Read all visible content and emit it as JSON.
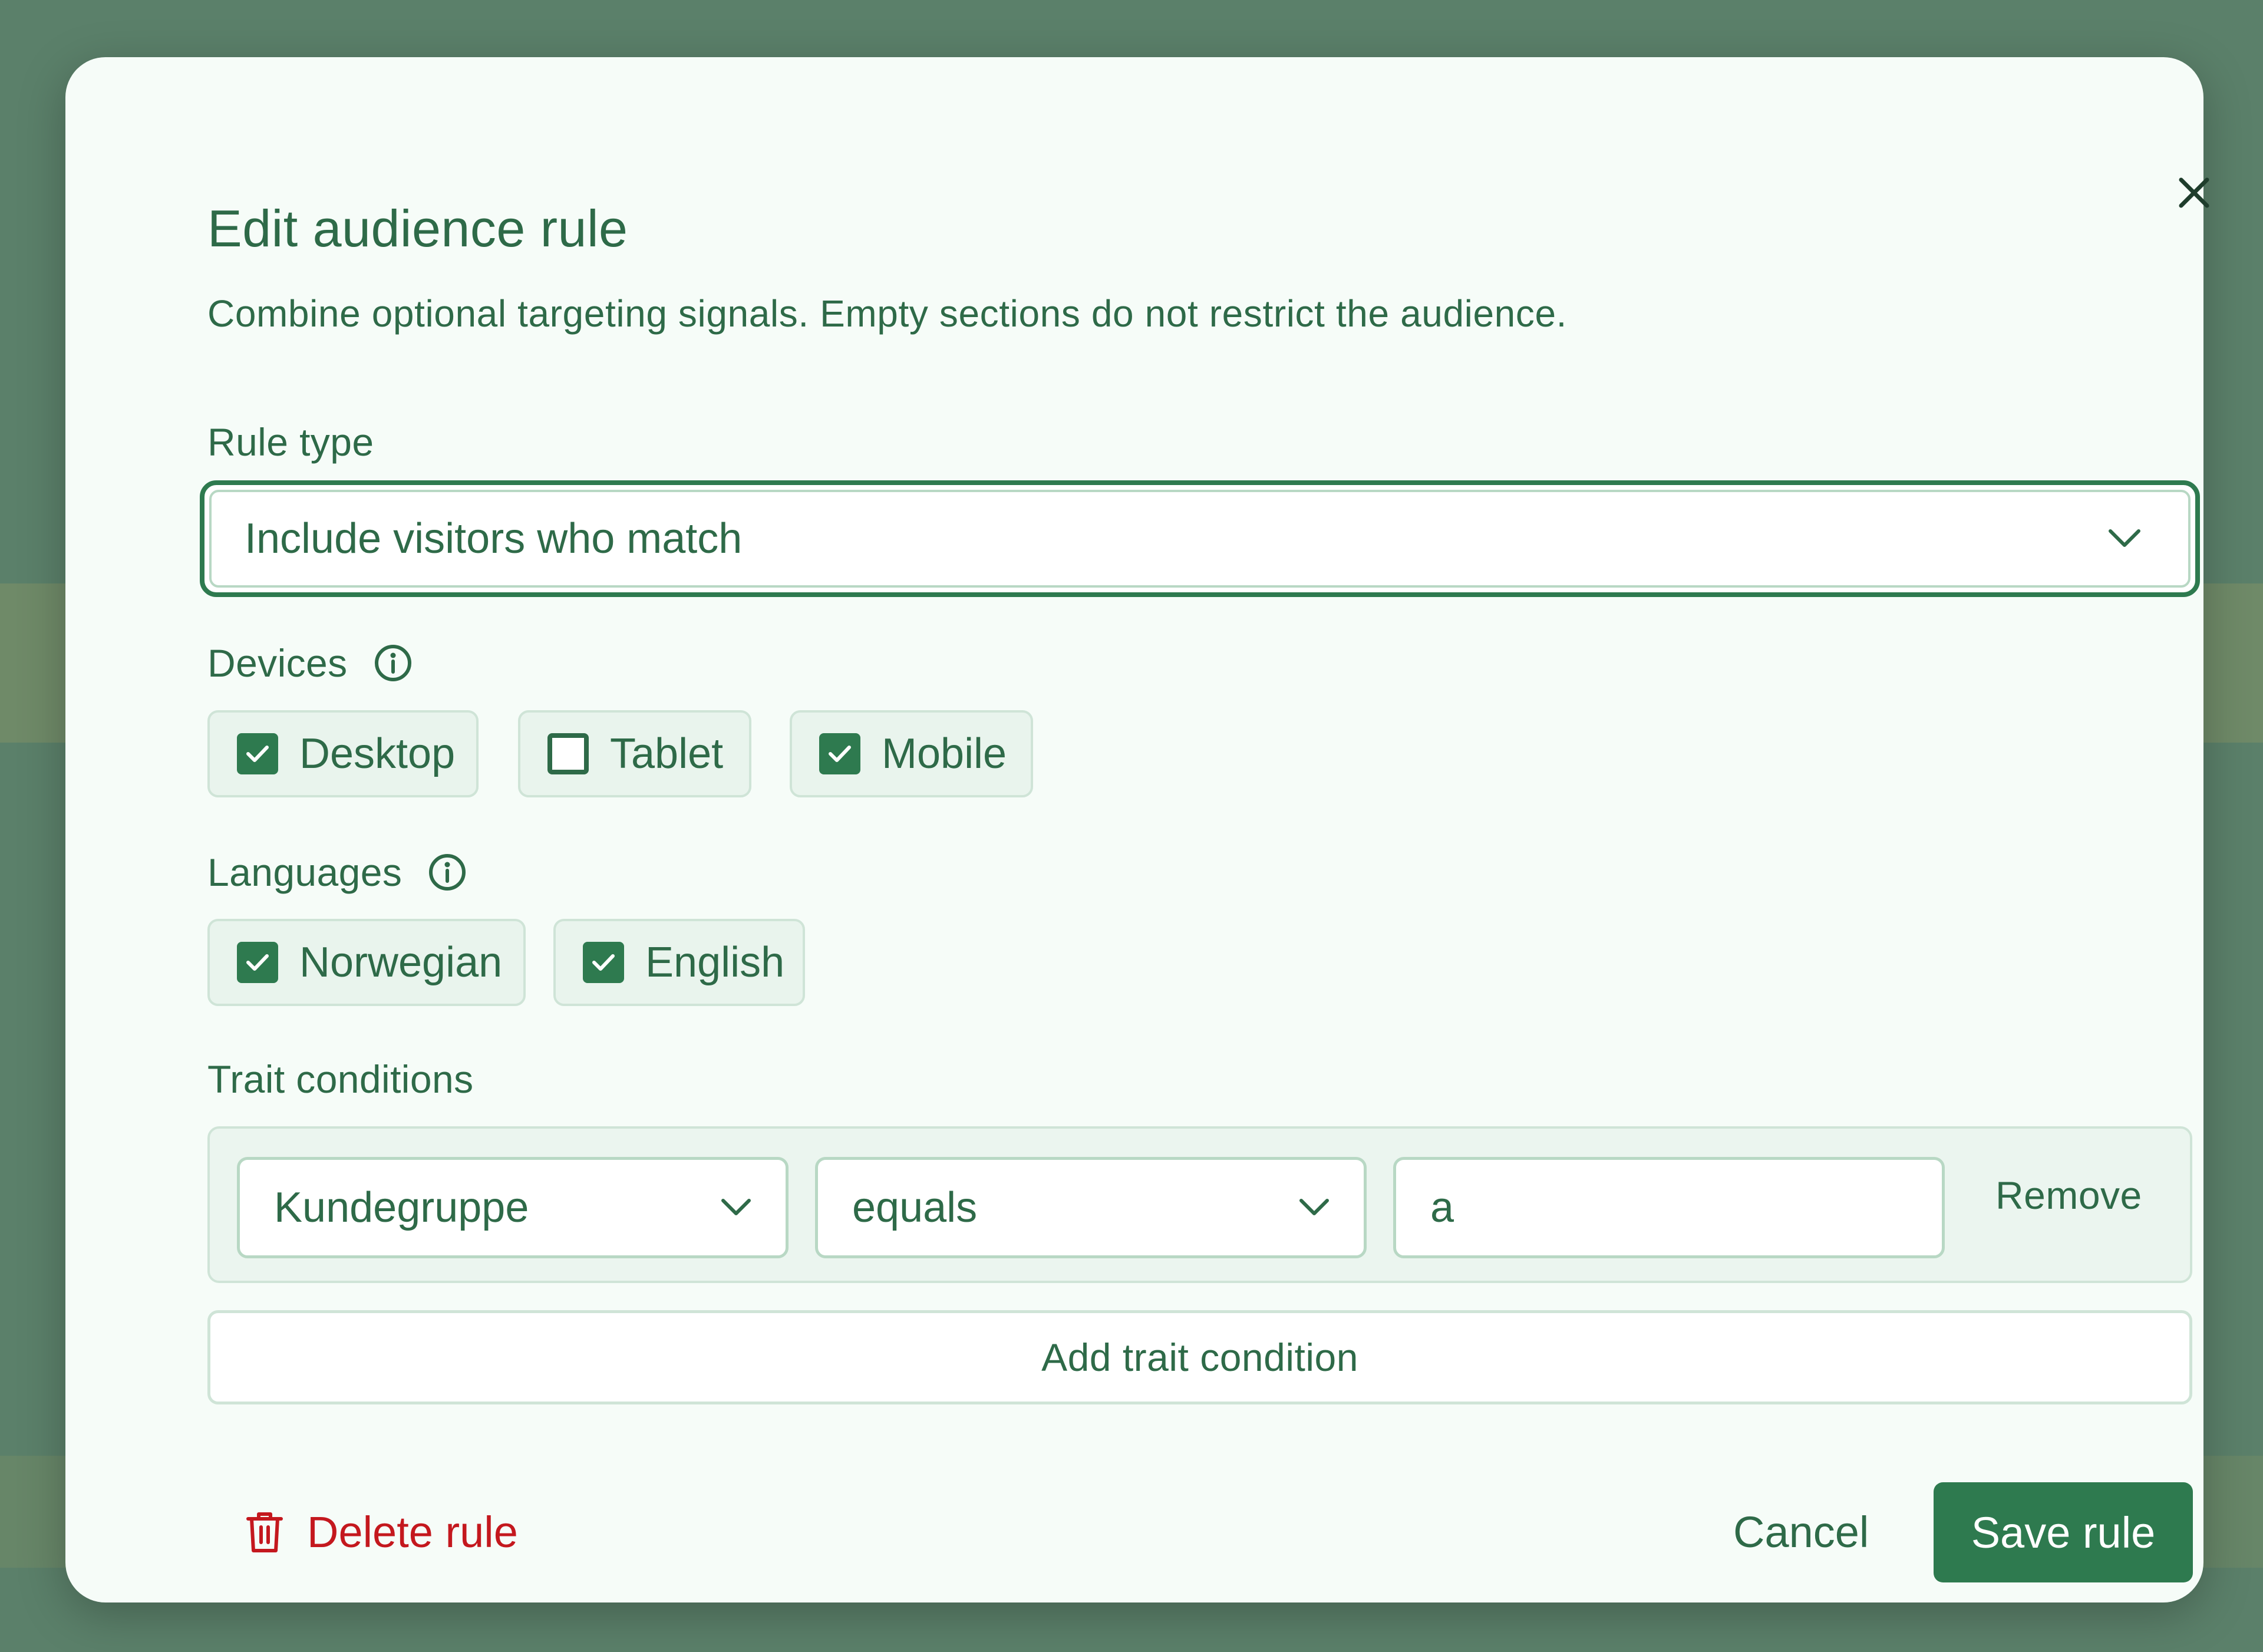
{
  "modal": {
    "title": "Edit audience rule",
    "subtitle": "Combine optional targeting signals. Empty sections do not restrict the audience."
  },
  "rule_type": {
    "label": "Rule type",
    "selected": "Include visitors who match"
  },
  "devices": {
    "label": "Devices",
    "options": [
      {
        "label": "Desktop",
        "checked": true
      },
      {
        "label": "Tablet",
        "checked": false
      },
      {
        "label": "Mobile",
        "checked": true
      }
    ]
  },
  "languages": {
    "label": "Languages",
    "options": [
      {
        "label": "Norwegian",
        "checked": true
      },
      {
        "label": "English",
        "checked": true
      }
    ]
  },
  "traits": {
    "label": "Trait conditions",
    "conditions": [
      {
        "trait": "Kundegruppe",
        "operator": "equals",
        "value": "a",
        "remove_label": "Remove"
      }
    ],
    "add_label": "Add trait condition"
  },
  "footer": {
    "delete_label": "Delete rule",
    "cancel_label": "Cancel",
    "save_label": "Save rule"
  },
  "icons": {
    "close": "close-icon",
    "info": "info-icon",
    "chevron": "chevron-down-icon",
    "check": "check-icon",
    "trash": "trash-icon"
  },
  "colors": {
    "accent": "#2e7a4f",
    "text": "#2e6a48",
    "danger": "#c4181e",
    "backdrop": "#5b806a",
    "modal_bg": "#f6fcf8"
  }
}
